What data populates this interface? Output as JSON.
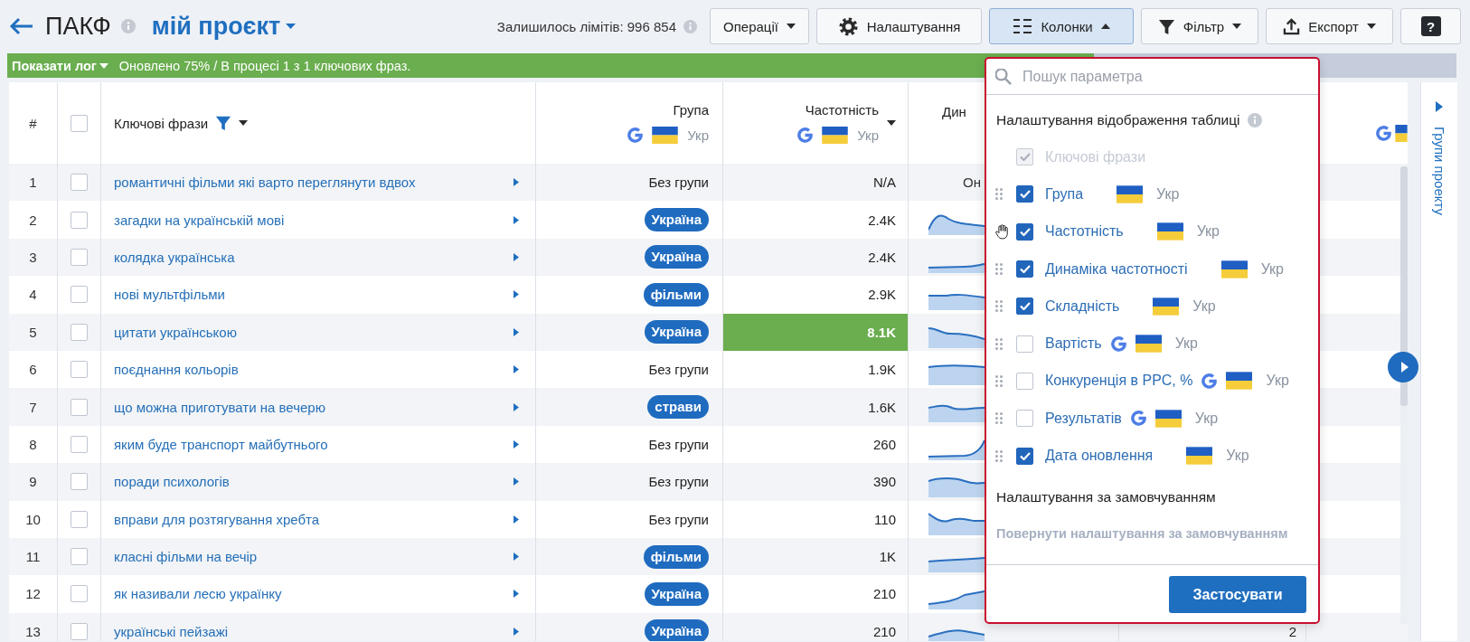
{
  "header": {
    "title": "ПАКФ",
    "project": "мій проєкт",
    "limits": "Залишилось лімітів: 996 854"
  },
  "toolbar": [
    {
      "kind": "operations",
      "label": "Операції",
      "selected": false,
      "expanded": false
    },
    {
      "kind": "settings",
      "label": "Налаштування",
      "selected": false
    },
    {
      "kind": "columns",
      "label": "Колонки",
      "selected": true,
      "expanded": true
    },
    {
      "kind": "filter",
      "label": "Фільтр",
      "selected": false,
      "expanded": false
    },
    {
      "kind": "export",
      "label": "Експорт",
      "selected": false,
      "expanded": false
    },
    {
      "kind": "help",
      "label": "?",
      "selected": false
    }
  ],
  "log": {
    "toggle": "Показати лог",
    "status": "Оновлено 75% / В процесі 1 з 1 ключових фраз.",
    "level": 0.75
  },
  "table": {
    "header": {
      "number": "#",
      "checked": false,
      "keyword": "Ключові фрази",
      "group": {
        "label": "Група",
        "region": "Укр"
      },
      "frequency": {
        "label": "Частотність",
        "region": "Укр"
      },
      "dynamics": "Дин"
    },
    "rows": [
      {
        "number": "1",
        "checked": false,
        "keyword": "романтичні фільми які варто переглянути вдвох",
        "group": {
          "kind": "plain",
          "label": "Без групи"
        },
        "frequency": "N/A",
        "highlighted": false,
        "dynamics": {
          "kind": "text",
          "text": "Он"
        }
      },
      {
        "number": "2",
        "checked": false,
        "keyword": "загадки на українській мові",
        "group": {
          "kind": "tag",
          "label": "Україна"
        },
        "frequency": "2.4K",
        "highlighted": false,
        "dynamics": {
          "kind": "sparkline"
        }
      },
      {
        "number": "3",
        "checked": false,
        "keyword": "колядка українська",
        "group": {
          "kind": "tag",
          "label": "Україна"
        },
        "frequency": "2.4K",
        "highlighted": false,
        "dynamics": {
          "kind": "sparkline"
        }
      },
      {
        "number": "4",
        "checked": false,
        "keyword": "нові мультфільми",
        "group": {
          "kind": "tag",
          "label": "фільми"
        },
        "frequency": "2.9K",
        "highlighted": false,
        "dynamics": {
          "kind": "sparkline"
        }
      },
      {
        "number": "5",
        "checked": false,
        "keyword": "цитати українською",
        "group": {
          "kind": "tag",
          "label": "Україна"
        },
        "frequency": "8.1K",
        "highlighted": true,
        "dynamics": {
          "kind": "sparkline"
        }
      },
      {
        "number": "6",
        "checked": false,
        "keyword": "поєднання кольорів",
        "group": {
          "kind": "plain",
          "label": "Без групи"
        },
        "frequency": "1.9K",
        "highlighted": false,
        "dynamics": {
          "kind": "sparkline"
        }
      },
      {
        "number": "7",
        "checked": false,
        "keyword": "що можна приготувати на вечерю",
        "group": {
          "kind": "tag",
          "label": "страви"
        },
        "frequency": "1.6K",
        "highlighted": false,
        "dynamics": {
          "kind": "sparkline"
        }
      },
      {
        "number": "8",
        "checked": false,
        "keyword": "яким буде транспорт майбутнього",
        "group": {
          "kind": "plain",
          "label": "Без групи"
        },
        "frequency": "260",
        "highlighted": false,
        "dynamics": {
          "kind": "sparkline"
        }
      },
      {
        "number": "9",
        "checked": false,
        "keyword": "поради психологів",
        "group": {
          "kind": "plain",
          "label": "Без групи"
        },
        "frequency": "390",
        "highlighted": false,
        "dynamics": {
          "kind": "sparkline"
        }
      },
      {
        "number": "10",
        "checked": false,
        "keyword": "вправи для розтягування хребта",
        "group": {
          "kind": "plain",
          "label": "Без групи"
        },
        "frequency": "110",
        "highlighted": false,
        "dynamics": {
          "kind": "sparkline"
        }
      },
      {
        "number": "11",
        "checked": false,
        "keyword": "класні фільми на вечір",
        "group": {
          "kind": "tag",
          "label": "фільми"
        },
        "frequency": "1K",
        "highlighted": false,
        "dynamics": {
          "kind": "sparkline"
        }
      },
      {
        "number": "12",
        "checked": false,
        "keyword": "як називали лесю українку",
        "group": {
          "kind": "tag",
          "label": "Україна"
        },
        "frequency": "210",
        "highlighted": false,
        "dynamics": {
          "kind": "sparkline"
        }
      },
      {
        "number": "13",
        "checked": false,
        "keyword": "українські пейзажі",
        "group": {
          "kind": "tag",
          "label": "Україна"
        },
        "frequency": "210",
        "highlighted": false,
        "dynamics": {
          "kind": "sparkline"
        },
        "column_7": "2"
      }
    ]
  },
  "column_panel": {
    "search_placeholder": "Пошук параметра",
    "title": "Налаштування відображення таблиці",
    "items": [
      {
        "kind": "fixed",
        "label": "Ключові фрази",
        "checked": true,
        "disabled": true
      },
      {
        "kind": "movable",
        "label": "Група",
        "checked": true,
        "disabled": false,
        "hovered": false,
        "google": false,
        "region": "Укр"
      },
      {
        "kind": "movable",
        "label": "Частотність",
        "checked": true,
        "disabled": false,
        "hovered": true,
        "google": false,
        "region": "Укр"
      },
      {
        "kind": "movable",
        "label": "Динаміка частотності",
        "checked": true,
        "disabled": false,
        "hovered": false,
        "google": false,
        "region": "Укр"
      },
      {
        "kind": "movable",
        "label": "Складність",
        "checked": true,
        "disabled": false,
        "hovered": false,
        "google": false,
        "region": "Укр"
      },
      {
        "kind": "movable",
        "label": "Вартість",
        "checked": false,
        "disabled": false,
        "hovered": false,
        "google": true,
        "region": "Укр"
      },
      {
        "kind": "movable",
        "label": "Конкуренція в PPC, %",
        "checked": false,
        "disabled": false,
        "hovered": false,
        "google": true,
        "region": "Укр"
      },
      {
        "kind": "movable",
        "label": "Результатів",
        "checked": false,
        "disabled": false,
        "hovered": false,
        "google": true,
        "region": "Укр"
      },
      {
        "kind": "movable",
        "label": "Дата оновлення",
        "checked": true,
        "disabled": false,
        "hovered": false,
        "google": false,
        "region": "Укр"
      }
    ],
    "defaults_title": "Налаштування за замовчуванням",
    "reset": {
      "label": "Повернути налаштування за замовчуванням",
      "disabled": true
    },
    "apply": "Застосувати"
  },
  "side_panel": {
    "label": "Групи проекту"
  }
}
